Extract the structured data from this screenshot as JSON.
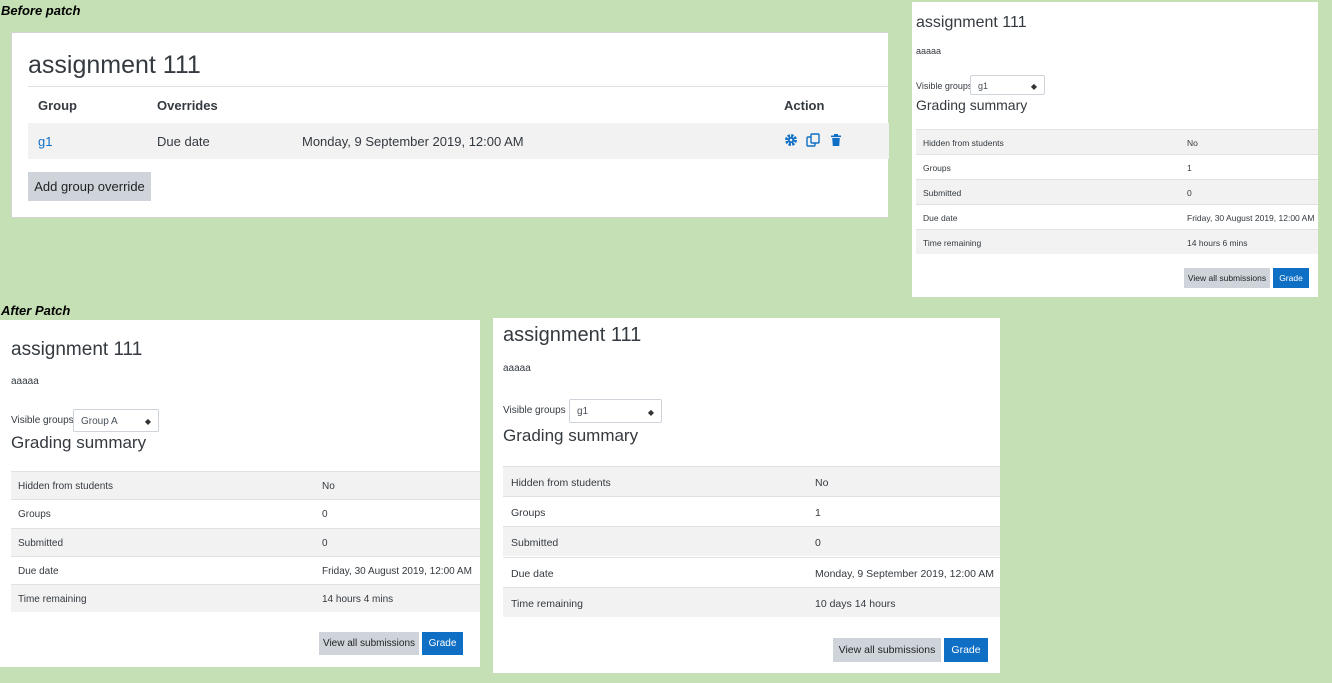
{
  "captions": {
    "before": "Before patch",
    "after": "After Patch"
  },
  "overrides": {
    "title": "assignment 111",
    "headers": {
      "group": "Group",
      "overrides": "Overrides",
      "action": "Action"
    },
    "row": {
      "group": "g1",
      "override": "Due date",
      "value": "Monday, 9 September 2019, 12:00 AM"
    },
    "add_button": "Add group override",
    "icons": [
      "gear-icon",
      "duplicate-icon",
      "trash-icon"
    ],
    "accent": "#0f6fc5"
  },
  "summaries": [
    {
      "title": "assignment 111",
      "description": "aaaaa",
      "visible_groups_label": "Visible groups",
      "selected_group": "g1",
      "grading_summary_title": "Grading summary",
      "rows": [
        {
          "label": "Hidden from students",
          "value": "No"
        },
        {
          "label": "Groups",
          "value": "1"
        },
        {
          "label": "Submitted",
          "value": "0"
        },
        {
          "label": "Due date",
          "value": "Friday, 30 August 2019, 12:00 AM"
        },
        {
          "label": "Time remaining",
          "value": "14 hours 6 mins"
        }
      ],
      "view_all": "View all submissions",
      "grade": "Grade"
    },
    {
      "title": "assignment 111",
      "description": "aaaaa",
      "visible_groups_label": "Visible groups",
      "selected_group": "Group A",
      "grading_summary_title": "Grading summary",
      "rows": [
        {
          "label": "Hidden from students",
          "value": "No"
        },
        {
          "label": "Groups",
          "value": "0"
        },
        {
          "label": "Submitted",
          "value": "0"
        },
        {
          "label": "Due date",
          "value": "Friday, 30 August 2019, 12:00 AM"
        },
        {
          "label": "Time remaining",
          "value": "14 hours 4 mins"
        }
      ],
      "view_all": "View all submissions",
      "grade": "Grade"
    },
    {
      "title": "assignment 111",
      "description": "aaaaa",
      "visible_groups_label": "Visible groups",
      "selected_group": "g1",
      "grading_summary_title": "Grading summary",
      "rows": [
        {
          "label": "Hidden from students",
          "value": "No"
        },
        {
          "label": "Groups",
          "value": "1"
        },
        {
          "label": "Submitted",
          "value": "0"
        },
        {
          "label": "Due date",
          "value": "Monday, 9 September 2019, 12:00 AM"
        },
        {
          "label": "Time remaining",
          "value": "10 days 14 hours"
        }
      ],
      "view_all": "View all submissions",
      "grade": "Grade"
    }
  ]
}
